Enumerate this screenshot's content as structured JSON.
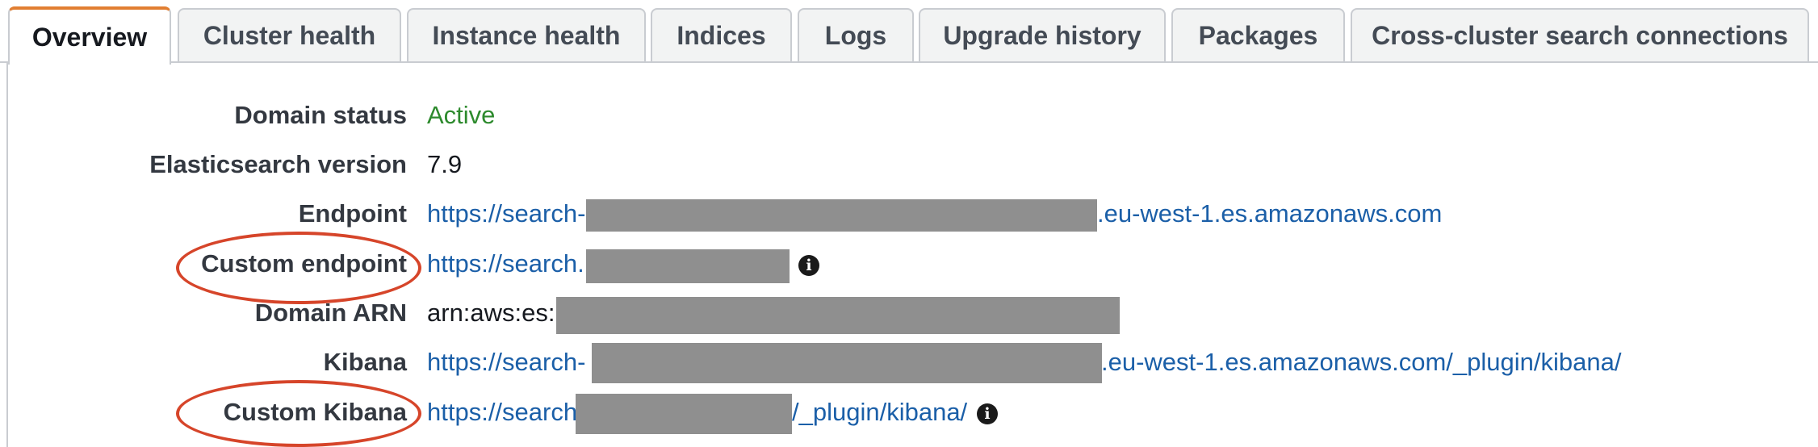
{
  "tabs": [
    {
      "label": "Overview",
      "active": true
    },
    {
      "label": "Cluster health",
      "active": false
    },
    {
      "label": "Instance health",
      "active": false
    },
    {
      "label": "Indices",
      "active": false
    },
    {
      "label": "Logs",
      "active": false
    },
    {
      "label": "Upgrade history",
      "active": false
    },
    {
      "label": "Packages",
      "active": false
    },
    {
      "label": "Cross-cluster search connections",
      "active": false
    }
  ],
  "details": {
    "domain_status": {
      "label": "Domain status",
      "value": "Active"
    },
    "es_version": {
      "label": "Elasticsearch version",
      "value": "7.9"
    },
    "endpoint": {
      "label": "Endpoint",
      "prefix": "https://search-",
      "suffix": ".eu-west-1.es.amazonaws.com"
    },
    "custom_endpoint": {
      "label": "Custom endpoint",
      "prefix": "https://search."
    },
    "domain_arn": {
      "label": "Domain ARN",
      "prefix": "arn:aws:es:"
    },
    "kibana": {
      "label": "Kibana",
      "prefix": "https://search-",
      "suffix": ".eu-west-1.es.amazonaws.com/_plugin/kibana/"
    },
    "custom_kibana": {
      "label": "Custom Kibana",
      "prefix": "https://search",
      "suffix": "/_plugin/kibana/"
    }
  },
  "colors": {
    "active_tab_accent": "#e17e31",
    "status_active": "#2d8a2d",
    "link": "#1b5fa8",
    "annotation_circle": "#d6452a",
    "redaction": "#8f8f8f"
  },
  "icons": {
    "info": "info-icon"
  }
}
